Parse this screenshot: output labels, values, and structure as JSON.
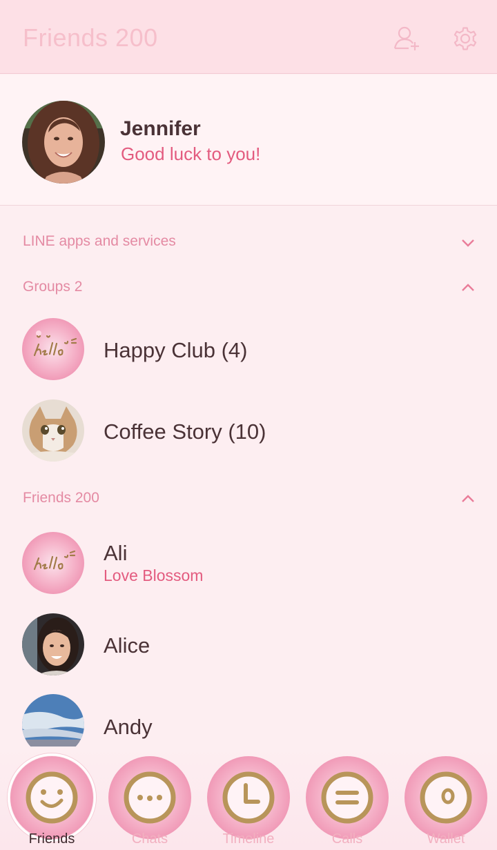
{
  "header": {
    "title": "Friends 200",
    "add_friend_icon": "add-friend-icon",
    "settings_icon": "gear-icon"
  },
  "profile": {
    "name": "Jennifer",
    "status": "Good luck to you!"
  },
  "sections": {
    "line_apps": "LINE apps and services",
    "groups": "Groups 2",
    "friends": "Friends 200"
  },
  "groups": [
    {
      "name": "Happy Club (4)"
    },
    {
      "name": "Coffee Story (10)"
    }
  ],
  "friends": [
    {
      "name": "Ali",
      "status": "Love Blossom"
    },
    {
      "name": "Alice",
      "status": ""
    },
    {
      "name": "Andy",
      "status": ""
    }
  ],
  "tabs": [
    {
      "label": "Friends",
      "icon": "smiley-face-icon",
      "active": true
    },
    {
      "label": "Chats",
      "icon": "chat-dots-icon",
      "active": false
    },
    {
      "label": "Timeline",
      "icon": "clock-icon",
      "active": false
    },
    {
      "label": "Calls",
      "icon": "calls-icon",
      "active": false
    },
    {
      "label": "Wallet",
      "icon": "wallet-icon",
      "active": false
    }
  ],
  "colors": {
    "accent": "#e35b7f",
    "header_bg": "#fde0e6",
    "section_text": "#e48aa3",
    "icon_gold": "#b8955a"
  }
}
